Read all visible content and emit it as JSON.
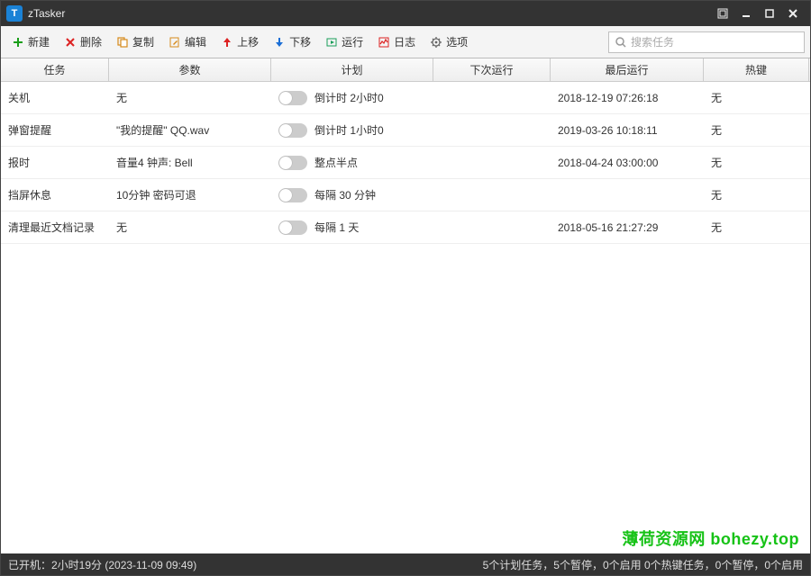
{
  "app": {
    "title": "zTasker"
  },
  "toolbar": {
    "new": "新建",
    "delete": "删除",
    "copy": "复制",
    "edit": "编辑",
    "moveUp": "上移",
    "moveDown": "下移",
    "run": "运行",
    "log": "日志",
    "options": "选项"
  },
  "search": {
    "placeholder": "搜索任务"
  },
  "columns": {
    "task": "任务",
    "param": "参数",
    "plan": "计划",
    "next": "下次运行",
    "last": "最后运行",
    "hotkey": "热键"
  },
  "rows": [
    {
      "task": "关机",
      "param": "无",
      "plan": "倒计时 2小时0",
      "next": "",
      "last": "2018-12-19 07:26:18",
      "hotkey": "无"
    },
    {
      "task": "弹窗提醒",
      "param": "\"我的提醒\" QQ.wav",
      "plan": "倒计时 1小时0",
      "next": "",
      "last": "2019-03-26 10:18:11",
      "hotkey": "无"
    },
    {
      "task": "报时",
      "param": "音量4 钟声: Bell",
      "plan": "整点半点",
      "next": "",
      "last": "2018-04-24 03:00:00",
      "hotkey": "无"
    },
    {
      "task": "挡屏休息",
      "param": "10分钟 密码可退",
      "plan": "每隔 30 分钟",
      "next": "",
      "last": "",
      "hotkey": "无"
    },
    {
      "task": "清理最近文档记录",
      "param": "无",
      "plan": "每隔 1 天",
      "next": "",
      "last": "2018-05-16 21:27:29",
      "hotkey": "无"
    }
  ],
  "watermark": "薄荷资源网 bohezy.top",
  "status": {
    "left": "已开机：2小时19分 (2023-11-09 09:49)",
    "right": "5个计划任务，5个暂停，0个启用   0个热键任务，0个暂停，0个启用"
  }
}
